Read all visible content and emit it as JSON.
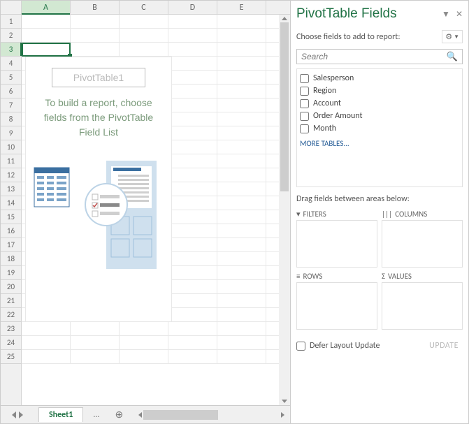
{
  "grid": {
    "columns": [
      "A",
      "B",
      "C",
      "D",
      "E"
    ],
    "rows": [
      "1",
      "2",
      "3",
      "4",
      "5",
      "6",
      "7",
      "8",
      "9",
      "10",
      "11",
      "12",
      "13",
      "14",
      "15",
      "16",
      "17",
      "18",
      "19",
      "20",
      "21",
      "22",
      "23",
      "24",
      "25"
    ],
    "active_col": "A",
    "active_row": "3",
    "pt_placeholder": {
      "title": "PivotTable1",
      "message": "To build a report, choose fields from the PivotTable Field List"
    }
  },
  "tabs": {
    "sheet1": "Sheet1",
    "more": "...",
    "new": "⊕"
  },
  "pane": {
    "title": "PivotTable Fields",
    "choose": "Choose fields to add to report:",
    "search_placeholder": "Search",
    "fields": [
      {
        "label": "Salesperson"
      },
      {
        "label": "Region"
      },
      {
        "label": "Account"
      },
      {
        "label": "Order Amount"
      },
      {
        "label": "Month"
      }
    ],
    "more_tables": "MORE TABLES...",
    "drag": "Drag fields between areas below:",
    "areas": {
      "filters": "FILTERS",
      "columns": "COLUMNS",
      "rows": "ROWS",
      "values": "VALUES"
    },
    "defer": "Defer Layout Update",
    "update": "UPDATE"
  }
}
